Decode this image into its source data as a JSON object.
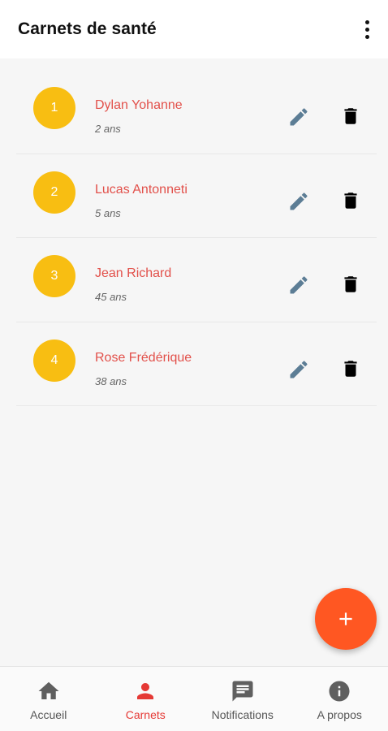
{
  "appbar": {
    "title": "Carnets de santé",
    "menu_icon": "more-vert-icon"
  },
  "carnets": [
    {
      "number": "1",
      "name": "Dylan Yohanne",
      "age": "2 ans"
    },
    {
      "number": "2",
      "name": "Lucas Antonneti",
      "age": "5 ans"
    },
    {
      "number": "3",
      "name": "Jean Richard",
      "age": "45 ans"
    },
    {
      "number": "4",
      "name": "Rose Frédérique",
      "age": "38 ans"
    }
  ],
  "row_actions": {
    "edit_icon": "pencil-icon",
    "delete_icon": "trash-icon"
  },
  "fab": {
    "icon": "plus-icon"
  },
  "bottom_nav": {
    "items": [
      {
        "label": "Accueil",
        "icon": "home-icon",
        "active": false
      },
      {
        "label": "Carnets",
        "icon": "person-icon",
        "active": true
      },
      {
        "label": "Notifications",
        "icon": "message-icon",
        "active": false
      },
      {
        "label": "A propos",
        "icon": "info-icon",
        "active": false
      }
    ]
  },
  "colors": {
    "accent": "#e53935",
    "avatar": "#f8be12",
    "name_text": "#e2504a",
    "fab": "#ff5722",
    "edit_icon": "#5c7d95",
    "nav_icon_inactive": "#5f5f5f"
  }
}
